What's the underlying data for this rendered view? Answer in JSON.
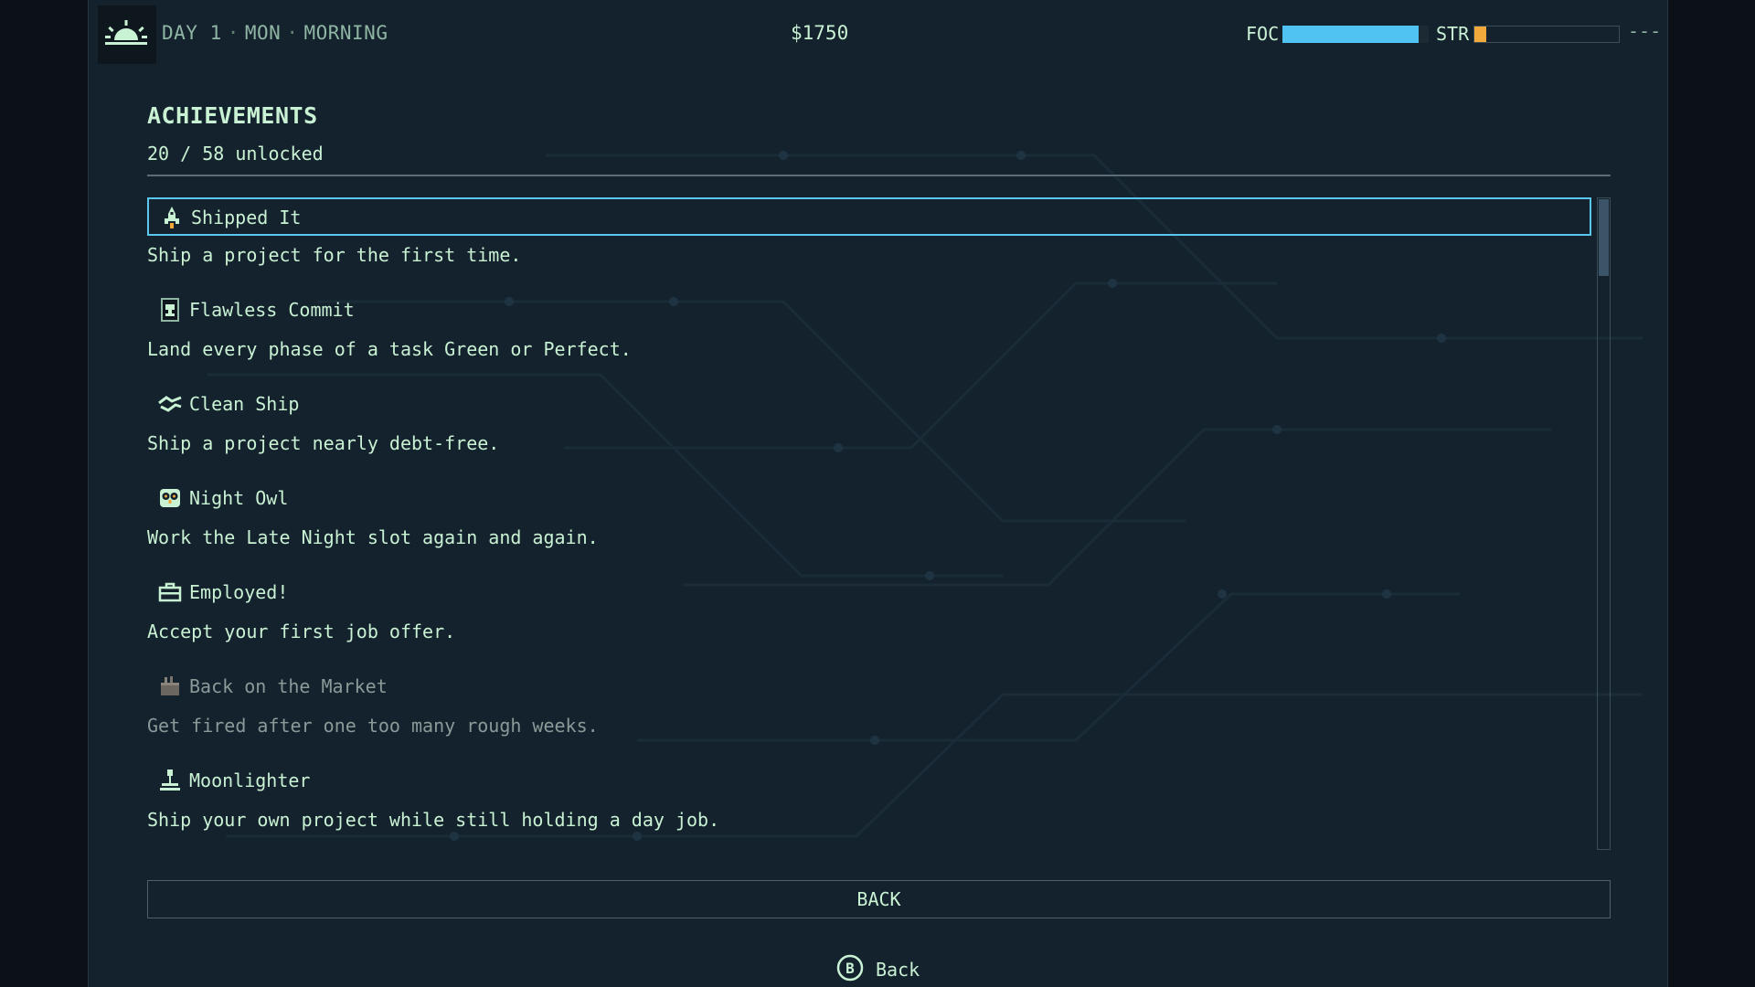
{
  "hud": {
    "day": "DAY 1",
    "weekday": "MON",
    "time_of_day": "MORNING",
    "separator": "·",
    "money": "$1750",
    "focus_label": "FOC",
    "focus_level": 0.93,
    "stress_label": "STR",
    "stress_level": 0.08,
    "extra": "---",
    "time_icon": "sunrise-icon"
  },
  "header": {
    "title": "ACHIEVEMENTS",
    "progress": "20 / 58 unlocked"
  },
  "achievements": [
    {
      "name": "Shipped It",
      "desc": "Ship a project for the first time.",
      "icon": "rocket-icon",
      "unlocked": true,
      "selected": true
    },
    {
      "name": "Flawless Commit",
      "desc": "Land every phase of a task Green or Perfect.",
      "icon": "trophy-card-icon",
      "unlocked": true
    },
    {
      "name": "Clean Ship",
      "desc": "Ship a project nearly debt-free.",
      "icon": "handshake-icon",
      "unlocked": true
    },
    {
      "name": "Night Owl",
      "desc": "Work the Late Night slot again and again.",
      "icon": "owl-icon",
      "unlocked": true
    },
    {
      "name": "Employed!",
      "desc": "Accept your first job offer.",
      "icon": "briefcase-icon",
      "unlocked": true
    },
    {
      "name": "Back on the Market",
      "desc": "Get fired after one too many rough weeks.",
      "icon": "box-icon",
      "unlocked": false
    },
    {
      "name": "Moonlighter",
      "desc": "Ship your own project while still holding a day job.",
      "icon": "desk-lamp-icon",
      "unlocked": true
    }
  ],
  "scroll_position": 0,
  "footer": {
    "back_button": "BACK",
    "hint_button": "B",
    "hint_label": "Back"
  },
  "colors": {
    "text": "#c9f1d3",
    "accent": "#5ac8ee",
    "focus": "#50c3f2",
    "stress": "#f2a93b",
    "panel": "#14222d"
  }
}
